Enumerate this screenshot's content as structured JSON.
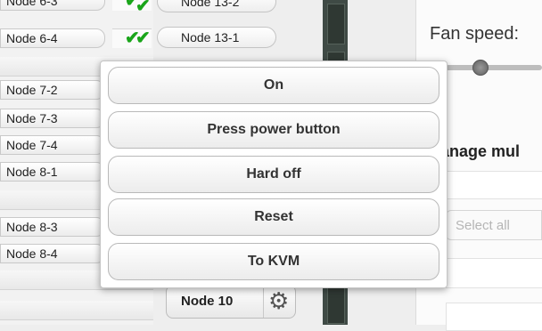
{
  "nodes_left": [
    "Node 6-3",
    "Node 6-4",
    "Node 7-2",
    "Node 7-3",
    "Node 7-4",
    "Node 8-1",
    "Node 8-3",
    "Node 8-4"
  ],
  "nodes_mid": [
    "Node 13-2",
    "Node 13-1"
  ],
  "check_glyph": "✔",
  "node10": {
    "label": "Node 10",
    "gear_glyph": "⚙"
  },
  "right": {
    "fan_label": "Fan speed:",
    "manage_label": "anage mul",
    "select_all": "Select all"
  },
  "menu": {
    "items": [
      "On",
      "Press power button",
      "Hard off",
      "Reset",
      "To KVM"
    ]
  },
  "colors": {
    "check": "#1aa51a",
    "strip": "#3f4a45"
  }
}
